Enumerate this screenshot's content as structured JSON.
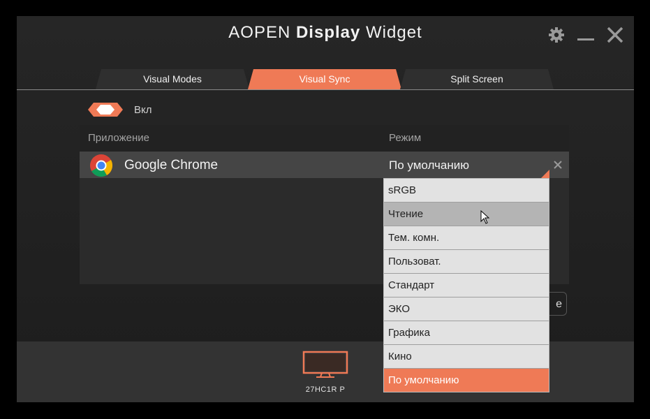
{
  "window": {
    "title_prefix": "AOPEN ",
    "title_bold": "Display",
    "title_suffix": " Widget",
    "controls": [
      "gear-icon",
      "minimize-icon",
      "close-icon"
    ]
  },
  "tabs": [
    {
      "label": "Visual Modes",
      "active": false
    },
    {
      "label": "Visual Sync",
      "active": true
    },
    {
      "label": "Split Screen",
      "active": false
    }
  ],
  "sync": {
    "toggle_label": "Вкл",
    "toggle_on": true
  },
  "table": {
    "col_app": "Приложение",
    "col_mode": "Режим",
    "rows": [
      {
        "app": "Google Chrome",
        "icon": "chrome-icon",
        "mode": "По умолчанию"
      }
    ]
  },
  "dropdown": {
    "options": [
      "sRGB",
      "Чтение",
      "Тем. комн.",
      "Пользоват.",
      "Стандарт",
      "ЭКО",
      "Графика",
      "Кино",
      "По умолчанию"
    ],
    "hovered": "Чтение",
    "selected": "По умолчанию"
  },
  "partial_button_text": "e",
  "monitor": {
    "label": "27HC1R P"
  },
  "colors": {
    "accent": "#ef7a56",
    "background": "#1d1d1d",
    "row": "#454545"
  }
}
